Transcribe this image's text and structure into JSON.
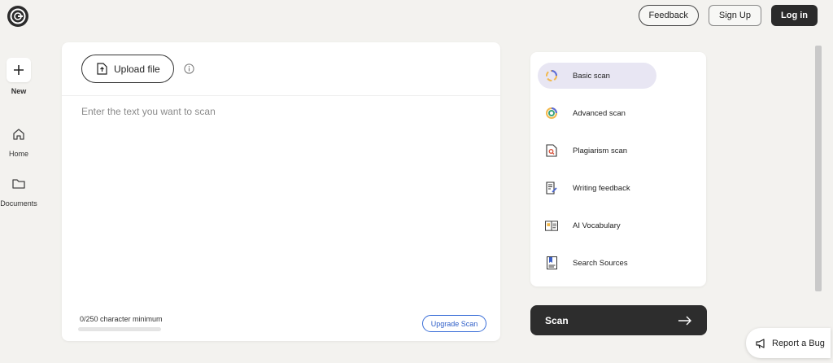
{
  "header": {
    "feedback_label": "Feedback",
    "signup_label": "Sign Up",
    "login_label": "Log in"
  },
  "sidebar": {
    "new_label": "New",
    "items": [
      {
        "label": "Home",
        "icon": "home-icon"
      },
      {
        "label": "Documents",
        "icon": "folder-icon"
      }
    ]
  },
  "editor": {
    "upload_label": "Upload file",
    "placeholder": "Enter the text you want to scan",
    "char_count": "0/250 character minimum",
    "upgrade_label": "Upgrade Scan"
  },
  "scan_options": [
    {
      "label": "Basic scan",
      "icon": "basic-scan-icon",
      "active": true
    },
    {
      "label": "Advanced scan",
      "icon": "advanced-scan-icon",
      "active": false
    },
    {
      "label": "Plagiarism scan",
      "icon": "plagiarism-scan-icon",
      "active": false
    },
    {
      "label": "Writing feedback",
      "icon": "writing-feedback-icon",
      "active": false
    },
    {
      "label": "AI Vocabulary",
      "icon": "ai-vocabulary-icon",
      "active": false
    },
    {
      "label": "Search Sources",
      "icon": "search-sources-icon",
      "active": false
    }
  ],
  "scan_button": {
    "label": "Scan"
  },
  "report_bug": {
    "label": "Report a Bug"
  },
  "colors": {
    "background": "#f3f2ef",
    "dark_button": "#2b2b2b",
    "active_option": "#e8e6f3",
    "upgrade_blue": "#2f5fc8"
  }
}
